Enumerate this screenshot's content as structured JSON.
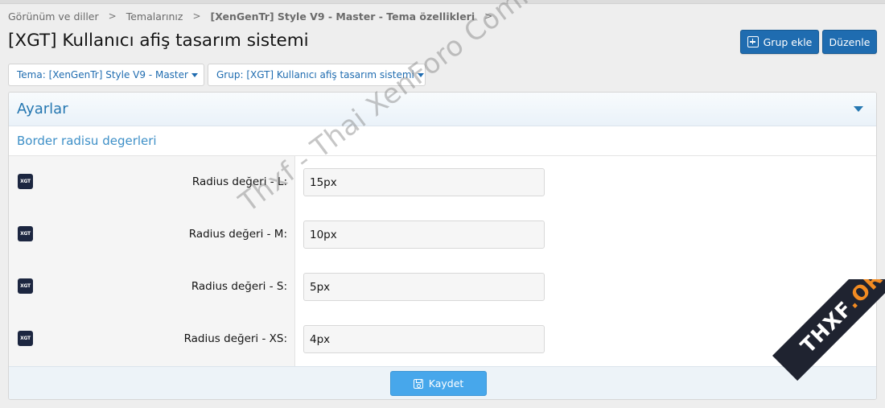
{
  "breadcrumb": {
    "items": [
      "Görünüm ve diller",
      "Temalarınız",
      "[XenGenTr] Style V9 - Master - Tema özellikleri"
    ],
    "separator": ">"
  },
  "page": {
    "title": "[XGT] Kullanıcı afiş tasarım sistemi"
  },
  "actions": {
    "add_group_label": "Grup ekle",
    "edit_label": "Düzenle"
  },
  "filters": {
    "theme": "Tema: [XenGenTr] Style V9 - Master",
    "group": "Grup: [XGT] Kullanıcı afiş tasarım sistemi"
  },
  "block": {
    "title": "Ayarlar",
    "section_title": "Border radisu degerleri",
    "rows": [
      {
        "badge": "XGT",
        "label": "Radius değeri - L:",
        "value": "15px"
      },
      {
        "badge": "XGT",
        "label": "Radius değeri - M:",
        "value": "10px"
      },
      {
        "badge": "XGT",
        "label": "Radius değeri - S:",
        "value": "5px"
      },
      {
        "badge": "XGT",
        "label": "Radius değeri - XS:",
        "value": "4px"
      }
    ],
    "save_label": "Kaydet"
  },
  "watermark": {
    "text": "Thxf - Thai XenForo Community",
    "corner_main": "THXF",
    "corner_accent": ".ORG"
  },
  "colors": {
    "primary": "#1f6cb0",
    "save_button": "#47a7eb",
    "header_text": "#2577b1",
    "badge": "#1c2640",
    "corner_accent": "#f28b22"
  }
}
